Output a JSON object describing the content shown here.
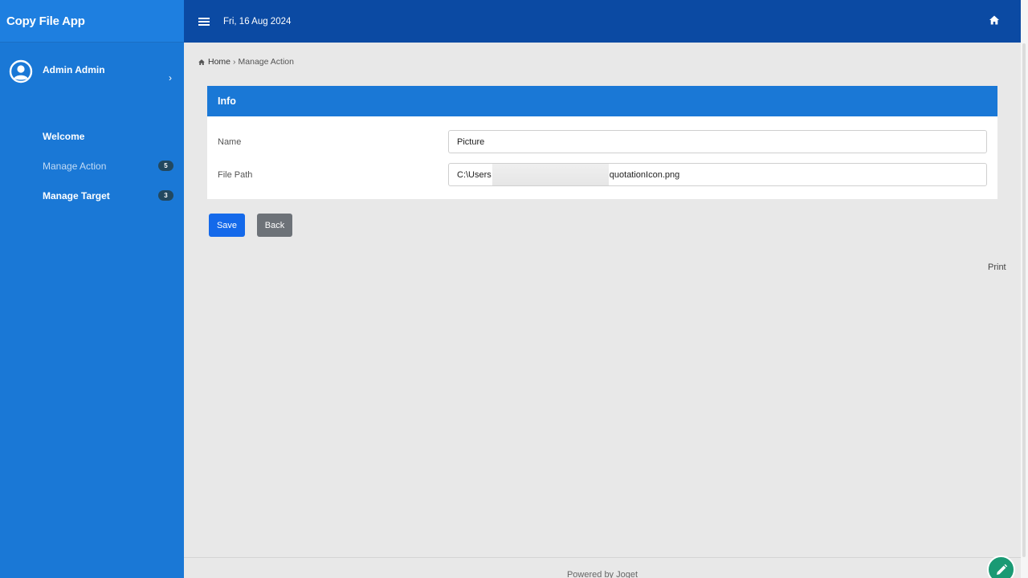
{
  "app": {
    "title": "Copy File App"
  },
  "user": {
    "name": "Admin Admin"
  },
  "sidebar": {
    "items": [
      {
        "label": "Welcome"
      },
      {
        "label": "Manage Action",
        "badge": "5"
      },
      {
        "label": "Manage Target",
        "badge": "3"
      }
    ]
  },
  "topbar": {
    "date": "Fri, 16 Aug 2024"
  },
  "breadcrumb": {
    "home": "Home",
    "separator": "›",
    "current": "Manage Action"
  },
  "form": {
    "header": "Info",
    "fields": [
      {
        "label": "Name",
        "value": "Picture"
      },
      {
        "label": "File Path",
        "value_prefix": "C:\\Users",
        "value_suffix": "quotationIcon.png"
      }
    ]
  },
  "buttons": {
    "save": "Save",
    "back": "Back"
  },
  "print_label": "Print",
  "footer": {
    "text": "Powered by Joget"
  },
  "colors": {
    "sidebar": "#1a78d6",
    "topbar": "#0b4aa3",
    "card_header": "#1a78d6",
    "save_button": "#1469ea",
    "back_button": "#6d7278",
    "badge": "#22485f",
    "edit_fab": "#1a9a74"
  },
  "icons": {
    "user": "user-circle-icon",
    "menu": "hamburger-icon",
    "home": "home-icon",
    "chevron": "chevron-right-icon",
    "edit": "pencil-icon"
  }
}
